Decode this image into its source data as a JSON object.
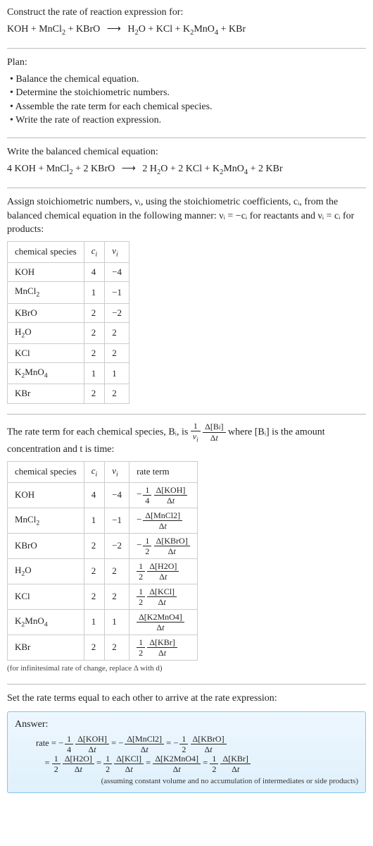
{
  "header": {
    "title": "Construct the rate of reaction expression for:",
    "equation": "KOH + MnCl₂ + KBrO ⟶ H₂O + KCl + K₂MnO₄ + KBr"
  },
  "plan": {
    "title": "Plan:",
    "items": [
      "Balance the chemical equation.",
      "Determine the stoichiometric numbers.",
      "Assemble the rate term for each chemical species.",
      "Write the rate of reaction expression."
    ]
  },
  "balanced": {
    "title": "Write the balanced chemical equation:",
    "equation": "4 KOH + MnCl₂ + 2 KBrO ⟶ 2 H₂O + 2 KCl + K₂MnO₄ + 2 KBr"
  },
  "stoich": {
    "intro": "Assign stoichiometric numbers, νᵢ, using the stoichiometric coefficients, cᵢ, from the balanced chemical equation in the following manner: νᵢ = −cᵢ for reactants and νᵢ = cᵢ for products:",
    "headers": [
      "chemical species",
      "cᵢ",
      "νᵢ"
    ],
    "rows": [
      {
        "species": "KOH",
        "c": "4",
        "v": "−4"
      },
      {
        "species": "MnCl₂",
        "c": "1",
        "v": "−1"
      },
      {
        "species": "KBrO",
        "c": "2",
        "v": "−2"
      },
      {
        "species": "H₂O",
        "c": "2",
        "v": "2"
      },
      {
        "species": "KCl",
        "c": "2",
        "v": "2"
      },
      {
        "species": "K₂MnO₄",
        "c": "1",
        "v": "1"
      },
      {
        "species": "KBr",
        "c": "2",
        "v": "2"
      }
    ]
  },
  "rateterm": {
    "intro_a": "The rate term for each chemical species, Bᵢ, is ",
    "intro_b": " where [Bᵢ] is the amount concentration and t is time:",
    "headers": [
      "chemical species",
      "cᵢ",
      "νᵢ",
      "rate term"
    ],
    "rows": [
      {
        "species": "KOH",
        "c": "4",
        "v": "−4",
        "neg": "−",
        "coef_n": "1",
        "coef_d": "4",
        "conc": "Δ[KOH]"
      },
      {
        "species": "MnCl₂",
        "c": "1",
        "v": "−1",
        "neg": "−",
        "coef_n": "",
        "coef_d": "",
        "conc": "Δ[MnCl2]"
      },
      {
        "species": "KBrO",
        "c": "2",
        "v": "−2",
        "neg": "−",
        "coef_n": "1",
        "coef_d": "2",
        "conc": "Δ[KBrO]"
      },
      {
        "species": "H₂O",
        "c": "2",
        "v": "2",
        "neg": "",
        "coef_n": "1",
        "coef_d": "2",
        "conc": "Δ[H2O]"
      },
      {
        "species": "KCl",
        "c": "2",
        "v": "2",
        "neg": "",
        "coef_n": "1",
        "coef_d": "2",
        "conc": "Δ[KCl]"
      },
      {
        "species": "K₂MnO₄",
        "c": "1",
        "v": "1",
        "neg": "",
        "coef_n": "",
        "coef_d": "",
        "conc": "Δ[K2MnO4]"
      },
      {
        "species": "KBr",
        "c": "2",
        "v": "2",
        "neg": "",
        "coef_n": "1",
        "coef_d": "2",
        "conc": "Δ[KBr]"
      }
    ],
    "note": "(for infinitesimal rate of change, replace Δ with d)"
  },
  "final": {
    "title": "Set the rate terms equal to each other to arrive at the rate expression:",
    "answer_label": "Answer:",
    "note": "(assuming constant volume and no accumulation of intermediates or side products)"
  },
  "chart_data": {
    "type": "table",
    "title": "Stoichiometric numbers and rate terms",
    "tables": [
      {
        "name": "stoichiometric numbers",
        "columns": [
          "chemical species",
          "c_i",
          "ν_i"
        ],
        "rows": [
          [
            "KOH",
            4,
            -4
          ],
          [
            "MnCl2",
            1,
            -1
          ],
          [
            "KBrO",
            2,
            -2
          ],
          [
            "H2O",
            2,
            2
          ],
          [
            "KCl",
            2,
            2
          ],
          [
            "K2MnO4",
            1,
            1
          ],
          [
            "KBr",
            2,
            2
          ]
        ]
      },
      {
        "name": "rate terms",
        "columns": [
          "chemical species",
          "c_i",
          "ν_i",
          "rate term"
        ],
        "rows": [
          [
            "KOH",
            4,
            -4,
            "-(1/4) Δ[KOH]/Δt"
          ],
          [
            "MnCl2",
            1,
            -1,
            "-Δ[MnCl2]/Δt"
          ],
          [
            "KBrO",
            2,
            -2,
            "-(1/2) Δ[KBrO]/Δt"
          ],
          [
            "H2O",
            2,
            2,
            "(1/2) Δ[H2O]/Δt"
          ],
          [
            "KCl",
            2,
            2,
            "(1/2) Δ[KCl]/Δt"
          ],
          [
            "K2MnO4",
            1,
            1,
            "Δ[K2MnO4]/Δt"
          ],
          [
            "KBr",
            2,
            2,
            "(1/2) Δ[KBr]/Δt"
          ]
        ]
      }
    ],
    "rate_expression": "rate = -(1/4) Δ[KOH]/Δt = -Δ[MnCl2]/Δt = -(1/2) Δ[KBrO]/Δt = (1/2) Δ[H2O]/Δt = (1/2) Δ[KCl]/Δt = Δ[K2MnO4]/Δt = (1/2) Δ[KBr]/Δt"
  }
}
